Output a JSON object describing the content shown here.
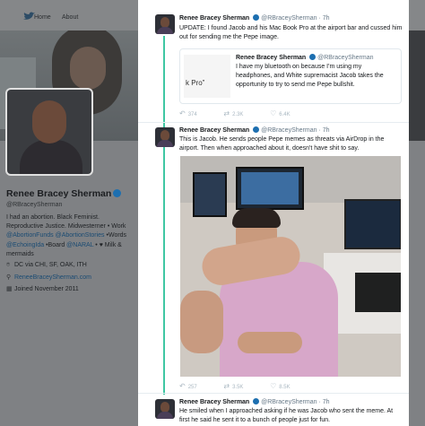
{
  "nav": {
    "home": "Home",
    "about": "About"
  },
  "profile": {
    "name": "Renee Bracey Sherman",
    "handle": "@RBraceySherman",
    "bio_plain_1": "I had an abortion. Black Feminist. Reproductive Justice. Midwesterner • Work",
    "bio_link_1": "@AbortionFunds",
    "bio_link_2": "@AbortionStories",
    "bio_plain_2": " •Words",
    "bio_link_3": "@EchoingIda",
    "bio_plain_3": " •Board ",
    "bio_link_4": "@NARAL",
    "bio_plain_4": " • ♥ Milk & mermaids",
    "location": "DC via CHI, SF, OAK, ITH",
    "website": "ReneeBraceySherman.com",
    "joined": "Joined November 2011"
  },
  "tweets": [
    {
      "name": "Renee Bracey Sherman",
      "handle": "@RBraceySherman · 7h",
      "text": "UPDATE: I found Jacob and his Mac Book Pro at the airport bar and cussed him out for sending me the Pepe image.",
      "quote": {
        "image_text": "k Pro”",
        "name": "Renee Bracey Sherman",
        "handle": "@RBraceySherman",
        "text": "I have my bluetooth on because I'm using my headphones, and White supremacist Jacob takes the opportunity to try to send me Pepe bullshit."
      },
      "replies": "374",
      "retweets": "2.3K",
      "likes": "6.4K"
    },
    {
      "name": "Renee Bracey Sherman",
      "handle": "@RBraceySherman · 7h",
      "text": "This is Jacob. He sends people Pepe memes as threats via AirDrop in the airport. Then when approached about it, doesn't have shit to say.",
      "replies": "257",
      "retweets": "3.5K",
      "likes": "8.5K"
    },
    {
      "name": "Renee Bracey Sherman",
      "handle": "@RBraceySherman · 7h",
      "text": "He smiled when I approached asking if he was Jacob who sent the meme. At first he said he sent it to a bunch of people just for fun."
    }
  ],
  "colors": {
    "thread_line": "#3fc7a3",
    "link": "#1a4b73",
    "verified": "#1d6fb0"
  },
  "icons": [
    "twitter-bird-icon",
    "home-icon",
    "verified-badge-icon",
    "location-icon",
    "link-icon",
    "calendar-icon",
    "reply-icon",
    "retweet-icon",
    "like-icon"
  ]
}
